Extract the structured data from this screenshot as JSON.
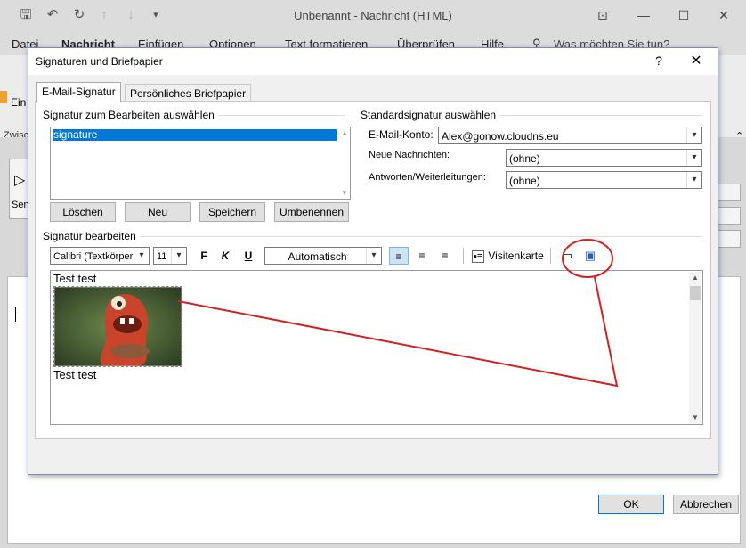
{
  "outlook": {
    "title": "Unbenannt  -  Nachricht (HTML)",
    "ribbon_tabs": [
      "Datei",
      "Nachricht",
      "Einfügen",
      "Optionen",
      "Text formatieren",
      "Überprüfen",
      "Hilfe"
    ],
    "tell_me": "Was möchten Sie tun?",
    "ribbon_partial_1": "Ein",
    "ribbon_partial_2": "Zwisc",
    "send_partial": "Sen"
  },
  "dialog": {
    "title": "Signaturen und Briefpapier",
    "help": "?",
    "tabs": [
      "E-Mail-Signatur",
      "Persönliches Briefpapier"
    ],
    "select_group_label": "Signatur zum Bearbeiten auswählen",
    "signatures": [
      "signature"
    ],
    "buttons": {
      "delete": "Löschen",
      "new": "Neu",
      "save": "Speichern",
      "rename": "Umbenennen"
    },
    "default_group_label": "Standardsignatur auswählen",
    "account_label": "E-Mail-Konto:",
    "account_value": "Alex@gonow.cloudns.eu",
    "new_messages_label": "Neue Nachrichten:",
    "new_messages_value": "(ohne)",
    "replies_label": "Antworten/Weiterleitungen:",
    "replies_value": "(ohne)",
    "edit_group_label": "Signatur bearbeiten",
    "font": "Calibri (Textkörper",
    "size": "11",
    "bold": "F",
    "italic": "K",
    "underline": "U",
    "color": "Automatisch",
    "business_card": "Visitenkarte",
    "content_line1": "Test test",
    "content_line2": "Test test",
    "ok": "OK",
    "cancel": "Abbrechen"
  },
  "annotation_color": "#d42020"
}
